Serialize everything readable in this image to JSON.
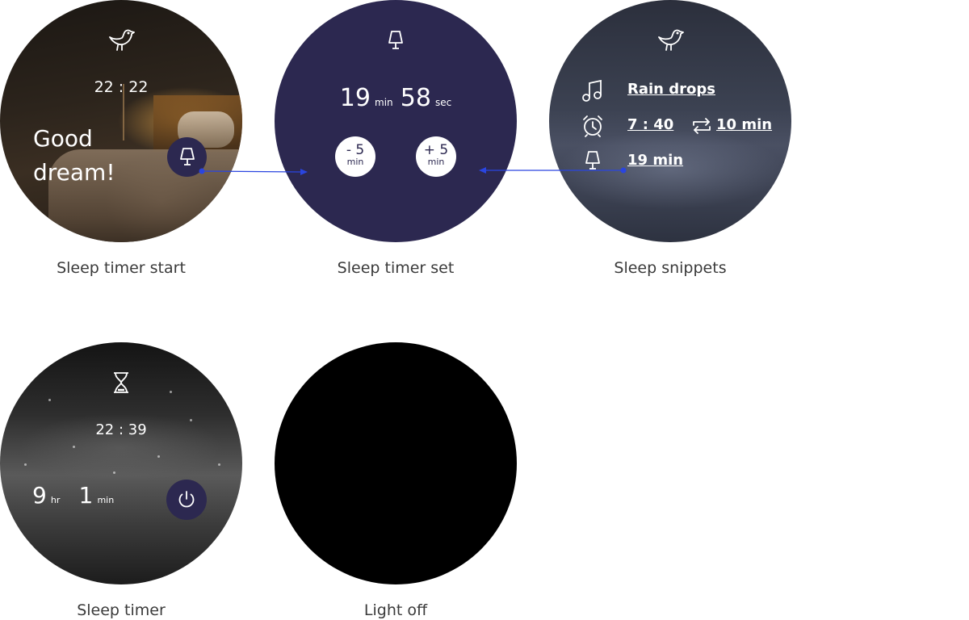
{
  "screens": [
    {
      "caption": "Sleep timer start",
      "time": "22 : 22",
      "greeting_line1": "Good",
      "greeting_line2": "dream!"
    },
    {
      "caption": "Sleep timer set",
      "minutes": "19",
      "minutes_unit": "min",
      "seconds": "58",
      "seconds_unit": "sec",
      "minus_label": "- 5",
      "minus_unit": "min",
      "plus_label": "+ 5",
      "plus_unit": "min"
    },
    {
      "caption": "Sleep snippets",
      "sound": "Rain drops",
      "alarm": "7 : 40",
      "repeat": "10 min",
      "timer": "19 min"
    },
    {
      "caption": "Sleep timer",
      "time": "22 : 39",
      "hours": "9",
      "hours_unit": "hr",
      "minutes": "1",
      "minutes_unit": "min"
    },
    {
      "caption": "Light off"
    }
  ],
  "colors": {
    "accent": "#2c2850",
    "arrow": "#2a45e0"
  },
  "icons": [
    "bird-icon",
    "lamp-icon",
    "music-note-icon",
    "alarm-clock-icon",
    "repeat-icon",
    "hourglass-icon",
    "power-icon"
  ]
}
